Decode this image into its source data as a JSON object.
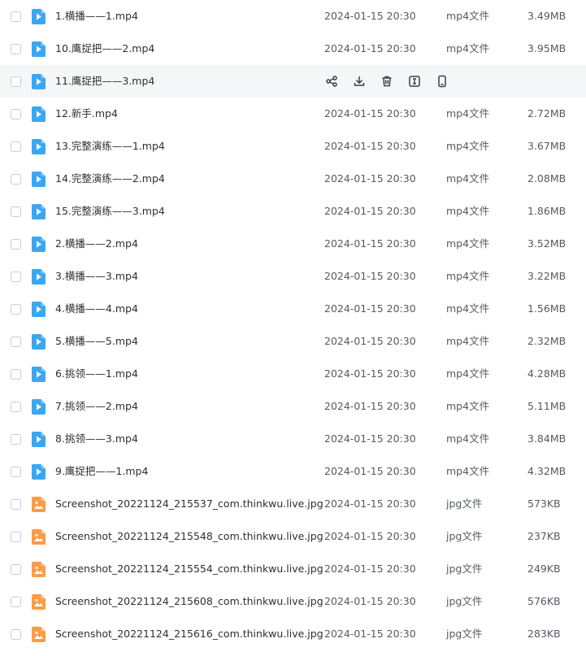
{
  "files": [
    {
      "name": "1.横播——1.mp4",
      "date": "2024-01-15 20:30",
      "type": "mp4文件",
      "size": "3.49MB",
      "kind": "video"
    },
    {
      "name": "10.鹰捉把——2.mp4",
      "date": "2024-01-15 20:30",
      "type": "mp4文件",
      "size": "3.95MB",
      "kind": "video"
    },
    {
      "name": "11.鹰捉把——3.mp4",
      "date": "",
      "type": "",
      "size": "",
      "kind": "video",
      "hover": true
    },
    {
      "name": "12.新手.mp4",
      "date": "2024-01-15 20:30",
      "type": "mp4文件",
      "size": "2.72MB",
      "kind": "video"
    },
    {
      "name": "13.完整演练——1.mp4",
      "date": "2024-01-15 20:30",
      "type": "mp4文件",
      "size": "3.67MB",
      "kind": "video"
    },
    {
      "name": "14.完整演练——2.mp4",
      "date": "2024-01-15 20:30",
      "type": "mp4文件",
      "size": "2.08MB",
      "kind": "video"
    },
    {
      "name": "15.完整演练——3.mp4",
      "date": "2024-01-15 20:30",
      "type": "mp4文件",
      "size": "1.86MB",
      "kind": "video"
    },
    {
      "name": "2.横播——2.mp4",
      "date": "2024-01-15 20:30",
      "type": "mp4文件",
      "size": "3.52MB",
      "kind": "video"
    },
    {
      "name": "3.横播——3.mp4",
      "date": "2024-01-15 20:30",
      "type": "mp4文件",
      "size": "3.22MB",
      "kind": "video"
    },
    {
      "name": "4.横播——4.mp4",
      "date": "2024-01-15 20:30",
      "type": "mp4文件",
      "size": "1.56MB",
      "kind": "video"
    },
    {
      "name": "5.横播——5.mp4",
      "date": "2024-01-15 20:30",
      "type": "mp4文件",
      "size": "2.32MB",
      "kind": "video"
    },
    {
      "name": "6.挑领——1.mp4",
      "date": "2024-01-15 20:30",
      "type": "mp4文件",
      "size": "4.28MB",
      "kind": "video"
    },
    {
      "name": "7.挑领——2.mp4",
      "date": "2024-01-15 20:30",
      "type": "mp4文件",
      "size": "5.11MB",
      "kind": "video"
    },
    {
      "name": "8.挑领——3.mp4",
      "date": "2024-01-15 20:30",
      "type": "mp4文件",
      "size": "3.84MB",
      "kind": "video"
    },
    {
      "name": "9.鹰捉把——1.mp4",
      "date": "2024-01-15 20:30",
      "type": "mp4文件",
      "size": "4.32MB",
      "kind": "video"
    },
    {
      "name": "Screenshot_20221124_215537_com.thinkwu.live.jpg",
      "date": "2024-01-15 20:30",
      "type": "jpg文件",
      "size": "573KB",
      "kind": "image"
    },
    {
      "name": "Screenshot_20221124_215548_com.thinkwu.live.jpg",
      "date": "2024-01-15 20:30",
      "type": "jpg文件",
      "size": "237KB",
      "kind": "image"
    },
    {
      "name": "Screenshot_20221124_215554_com.thinkwu.live.jpg",
      "date": "2024-01-15 20:30",
      "type": "jpg文件",
      "size": "249KB",
      "kind": "image"
    },
    {
      "name": "Screenshot_20221124_215608_com.thinkwu.live.jpg",
      "date": "2024-01-15 20:30",
      "type": "jpg文件",
      "size": "576KB",
      "kind": "image"
    },
    {
      "name": "Screenshot_20221124_215616_com.thinkwu.live.jpg",
      "date": "2024-01-15 20:30",
      "type": "jpg文件",
      "size": "283KB",
      "kind": "image"
    }
  ],
  "hover_actions": [
    "share-icon",
    "download-icon",
    "delete-icon",
    "rename-icon",
    "mobile-icon"
  ],
  "colors": {
    "video_icon": "#3aa7f5",
    "image_icon": "#ff9b45",
    "hover_row_bg": "#f5f6f8",
    "action_icon": "#3b3f46"
  }
}
